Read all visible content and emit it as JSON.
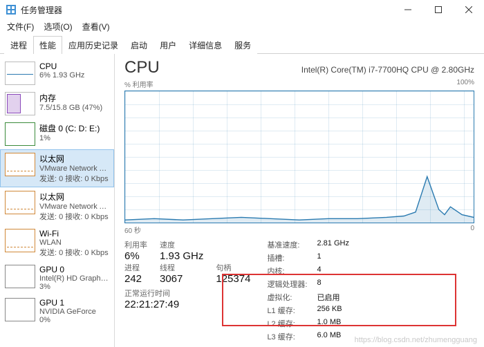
{
  "window": {
    "title": "任务管理器"
  },
  "menu": {
    "file": "文件(F)",
    "options": "选项(O)",
    "view": "查看(V)"
  },
  "tabs": {
    "t0": "进程",
    "t1": "性能",
    "t2": "应用历史记录",
    "t3": "启动",
    "t4": "用户",
    "t5": "详细信息",
    "t6": "服务"
  },
  "sidebar": {
    "cpu": {
      "title": "CPU",
      "sub": "6% 1.93 GHz"
    },
    "mem": {
      "title": "内存",
      "sub": "7.5/15.8 GB (47%)"
    },
    "disk": {
      "title": "磁盘 0 (C: D: E:)",
      "sub": "1%"
    },
    "eth0": {
      "title": "以太网",
      "sub1": "VMware Network Adapter",
      "sub2": "发送: 0 接收: 0 Kbps"
    },
    "eth1": {
      "title": "以太网",
      "sub1": "VMware Network Adapter",
      "sub2": "发送: 0 接收: 0 Kbps"
    },
    "wifi": {
      "title": "Wi-Fi",
      "sub1": "WLAN",
      "sub2": "发送: 0 接收: 0 Kbps"
    },
    "gpu0": {
      "title": "GPU 0",
      "sub1": "Intel(R) HD Graphics",
      "sub2": "3%"
    },
    "gpu1": {
      "title": "GPU 1",
      "sub1": "NVIDIA GeForce",
      "sub2": "0%"
    }
  },
  "header": {
    "title": "CPU",
    "device": "Intel(R) Core(TM) i7-7700HQ CPU @ 2.80GHz"
  },
  "axis": {
    "label": "% 利用率",
    "max": "100%",
    "span": "60 秒",
    "zero": "0"
  },
  "statsA": {
    "util_l": "利用率",
    "util_v": "6%",
    "speed_l": "速度",
    "speed_v": "1.93 GHz",
    "proc_l": "进程",
    "proc_v": "242",
    "thr_l": "线程",
    "thr_v": "3067",
    "hnd_l": "句柄",
    "hnd_v": "125374",
    "up_l": "正常运行时间",
    "up_v": "22:21:27:49"
  },
  "statsB": {
    "base_l": "基准速度:",
    "base_v": "2.81 GHz",
    "sock_l": "插槽:",
    "sock_v": "1",
    "core_l": "内核:",
    "core_v": "4",
    "lp_l": "逻辑处理器:",
    "lp_v": "8",
    "virt_l": "虚拟化:",
    "virt_v": "已启用",
    "l1_l": "L1 缓存:",
    "l1_v": "256 KB",
    "l2_l": "L2 缓存:",
    "l2_v": "1.0 MB",
    "l3_l": "L3 缓存:",
    "l3_v": "6.0 MB"
  },
  "chart_data": {
    "type": "line",
    "title": "% 利用率",
    "xlabel": "60 秒",
    "ylabel": "% 利用率",
    "ylim": [
      0,
      100
    ],
    "x": [
      0,
      5,
      10,
      15,
      20,
      25,
      30,
      35,
      40,
      45,
      48,
      50,
      52,
      54,
      55,
      56,
      58,
      60
    ],
    "values": [
      2,
      3,
      2,
      3,
      4,
      3,
      2,
      3,
      3,
      4,
      5,
      8,
      35,
      10,
      6,
      12,
      6,
      4
    ]
  },
  "watermark": "https://blog.csdn.net/zhumengguang"
}
